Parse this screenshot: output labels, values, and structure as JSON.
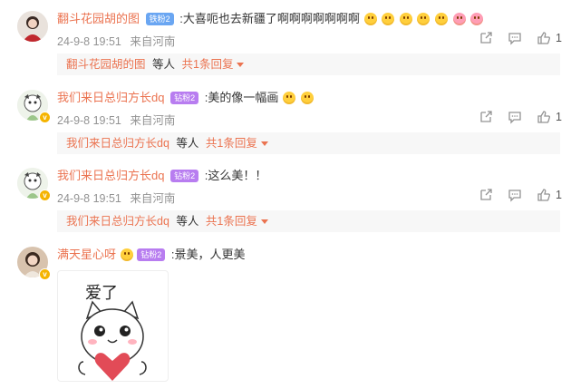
{
  "comments": [
    {
      "username": "翻斗花园胡的图",
      "badge": "铁粉2",
      "text": ":大喜呃也去新疆了啊啊啊啊啊啊啊",
      "emojis": [
        "grin",
        "kiss",
        "kiss",
        "smile",
        "smile",
        "heart-eyes",
        "heart-eyes"
      ],
      "timestamp": "24-9-8 19:51",
      "location": "来自河南",
      "likes": "1",
      "reply": {
        "username": "翻斗花园胡的图",
        "etc": "等人",
        "more": "共1条回复"
      }
    },
    {
      "username": "我们来日总归方长dq",
      "badge": "钻粉2",
      "text": ":美的像一幅画",
      "emojis": [
        "laugh-cry",
        "laugh-cry"
      ],
      "timestamp": "24-9-8 19:51",
      "location": "来自河南",
      "likes": "1",
      "reply": {
        "username": "我们来日总归方长dq",
        "etc": "等人",
        "more": "共1条回复"
      }
    },
    {
      "username": "我们来日总归方长dq",
      "badge": "钻粉2",
      "text": ":这么美！！",
      "emojis": [],
      "timestamp": "24-9-8 19:51",
      "location": "来自河南",
      "likes": "1",
      "reply": {
        "username": "我们来日总归方长dq",
        "etc": "等人",
        "more": "共1条回复"
      }
    },
    {
      "username": "满天星心呀",
      "badge": "钻粉2",
      "text": ":景美，人更美",
      "emojis": [],
      "sticker_text": "爱了"
    }
  ],
  "icons": {
    "forward": "share-icon",
    "comment": "comment-icon",
    "like": "thumbs-up-icon"
  },
  "colors": {
    "accent": "#eb7350",
    "meta": "#939393",
    "reply_bg": "#f7f7f7",
    "badge_iron": "#6aa6f2",
    "badge_diamond": "#b87df0"
  }
}
